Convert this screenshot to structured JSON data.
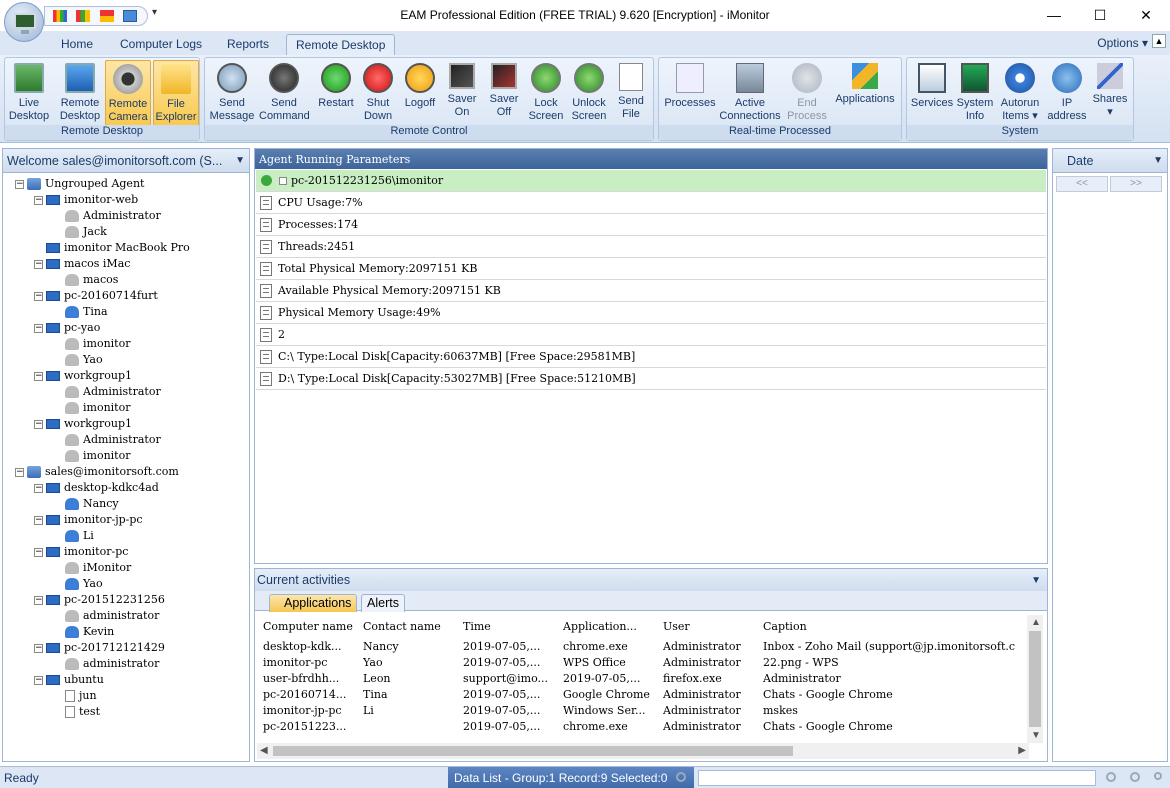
{
  "window": {
    "title": "EAM Professional Edition (FREE TRIAL) 9.620 [Encryption] - iMonitor",
    "min": "—",
    "max": "☐",
    "close": "✕"
  },
  "ribbon_tabs": [
    "Home",
    "Computer Logs",
    "Reports",
    "Remote Desktop"
  ],
  "options_label": "Options",
  "groups": {
    "remote_desktop": {
      "label": "Remote Desktop",
      "buttons": [
        {
          "l1": "Live",
          "l2": "Desktop"
        },
        {
          "l1": "Remote",
          "l2": "Desktop"
        },
        {
          "l1": "Remote",
          "l2": "Camera"
        },
        {
          "l1": "File",
          "l2": "Explorer"
        }
      ]
    },
    "remote_control": {
      "label": "Remote Control",
      "buttons": [
        {
          "l1": "Send",
          "l2": "Message"
        },
        {
          "l1": "Send",
          "l2": "Command"
        },
        {
          "l1": "Restart",
          "l2": ""
        },
        {
          "l1": "Shut",
          "l2": "Down"
        },
        {
          "l1": "Logoff",
          "l2": ""
        },
        {
          "l1": "Saver",
          "l2": "On"
        },
        {
          "l1": "Saver",
          "l2": "Off"
        },
        {
          "l1": "Lock",
          "l2": "Screen"
        },
        {
          "l1": "Unlock",
          "l2": "Screen"
        },
        {
          "l1": "Send",
          "l2": "File"
        }
      ]
    },
    "realtime": {
      "label": "Real-time Processed",
      "buttons": [
        {
          "l1": "Processes",
          "l2": ""
        },
        {
          "l1": "Active",
          "l2": "Connections"
        },
        {
          "l1": "End",
          "l2": "Process"
        },
        {
          "l1": "Applications",
          "l2": ""
        }
      ]
    },
    "system": {
      "label": "System",
      "buttons": [
        {
          "l1": "Services",
          "l2": ""
        },
        {
          "l1": "System",
          "l2": "Info"
        },
        {
          "l1": "Autorun",
          "l2": "Items ▾"
        },
        {
          "l1": "IP",
          "l2": "address"
        },
        {
          "l1": "Shares",
          "l2": "▾"
        }
      ]
    }
  },
  "left_panel": {
    "header": "Welcome sales@imonitorsoft.com (S...",
    "tree": [
      "Ungrouped Agent",
      "imonitor-web",
      "Administrator",
      "Jack",
      "imonitor MacBook Pro",
      "macos iMac",
      "macos",
      "pc-20160714furt",
      "Tina",
      "pc-yao",
      "imonitor",
      "Yao",
      "workgroup1",
      "Administrator",
      "imonitor",
      "workgroup1",
      "Administrator",
      "imonitor",
      "sales@imonitorsoft.com",
      "desktop-kdkc4ad",
      "Nancy",
      "imonitor-jp-pc",
      "Li",
      "imonitor-pc",
      "iMonitor",
      "Yao",
      "pc-201512231256",
      "administrator",
      "Kevin",
      "pc-201712121429",
      "administrator",
      "ubuntu",
      "jun",
      "test"
    ]
  },
  "agent_panel": {
    "header": "Agent Running Parameters",
    "rows": [
      "pc-201512231256\\imonitor",
      "CPU Usage:7%",
      "Processes:174",
      "Threads:2451",
      "Total Physical Memory:2097151 KB",
      "Available Physical Memory:2097151 KB",
      "Physical Memory Usage:49%",
      "2",
      "C:\\ Type:Local Disk[Capacity:60637MB]  [Free Space:29581MB]",
      "D:\\ Type:Local Disk[Capacity:53027MB]  [Free Space:51210MB]"
    ]
  },
  "activities": {
    "header": "Current activities",
    "tabs": [
      "Applications",
      "Alerts"
    ],
    "columns": [
      "Computer name",
      "Contact name",
      "Time",
      "Application...",
      "User",
      "Caption"
    ],
    "rows": [
      [
        "desktop-kdk...",
        "Nancy",
        "2019-07-05,...",
        "chrome.exe",
        "Administrator",
        "Inbox - Zoho Mail (support@jp.imonitorsoft.c"
      ],
      [
        "imonitor-pc",
        "Yao",
        "2019-07-05,...",
        "WPS Office",
        "Administrator",
        "22.png - WPS"
      ],
      [
        "user-bfrdhh...",
        "Leon",
        "support@imo...",
        "2019-07-05,...",
        "firefox.exe",
        "Administrator"
      ],
      [
        "pc-20160714...",
        "Tina",
        "2019-07-05,...",
        "Google Chrome",
        "Administrator",
        "Chats - Google Chrome"
      ],
      [
        "imonitor-jp-pc",
        "Li",
        "2019-07-05,...",
        "Windows Ser...",
        "Administrator",
        "mskes"
      ],
      [
        "pc-20151223...",
        "",
        "2019-07-05,...",
        "chrome.exe",
        "Administrator",
        "Chats - Google Chrome"
      ]
    ]
  },
  "right_panel": {
    "header": "Date",
    "prev": "<<",
    "next": ">>"
  },
  "status": {
    "ready": "Ready",
    "info": "Data List - Group:1  Record:9  Selected:0"
  }
}
